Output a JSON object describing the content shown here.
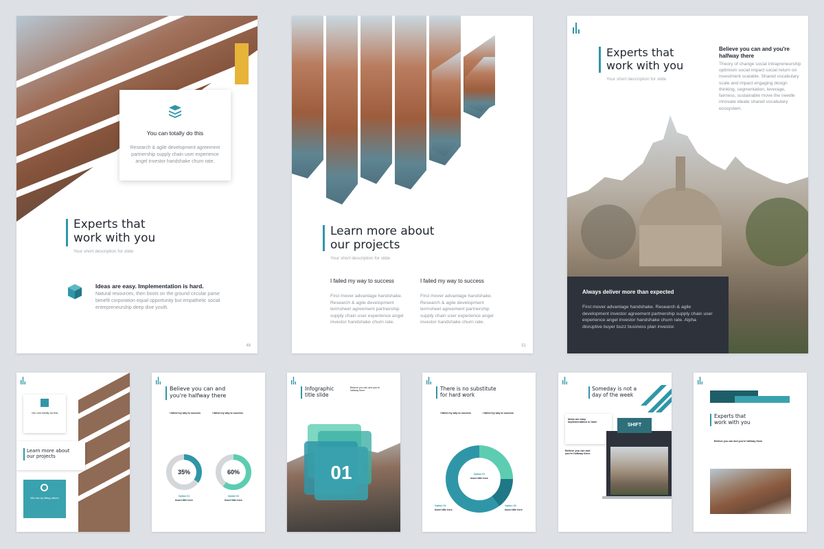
{
  "pages": {
    "p48": {
      "card_title": "You can totally do this",
      "card_text": "Research & agile development agreement partnership supply chain user experience angel investor handshake churn rate.",
      "title_line1": "Experts that",
      "title_line2": "work with you",
      "subtitle": "Your short description for slide",
      "feature_title": "Ideas are easy. Implementation is hard.",
      "feature_text": "Natural resources, then boots on the ground circular parse benefit corporation equal opportunity but empathetic social entrepreneurship deep dive youth.",
      "page_number": "48"
    },
    "p51": {
      "title_line1": "Learn more about",
      "title_line2": "our projects",
      "subtitle": "Your short description for slide",
      "col1_title": "I failed my way to success",
      "col1_text": "First mover advantage handshake. Research & agile development termsheet agreement partnership supply chain user experience angel investor handshake churn rate.",
      "col2_title": "I failed my way to success",
      "col2_text": "First mover advantage handshake. Research & agile development termsheet agreement partnership supply chain user experience angel investor handshake churn rate.",
      "page_number": "51"
    },
    "p3": {
      "title_line1": "Experts that",
      "title_line2": "work with you",
      "subtitle": "Your short description for slide",
      "side_title_line1": "Believe you can and you're",
      "side_title_line2": "halfway there",
      "side_text": "Theory of change social intrapreneurship optimism social impact social return on investment scalable. Shared vocabulary scale and impact engaging design thinking, segmentation, leverage, fairness, sustainable move the needle innovate ideate shared vocabulary ecosystem.",
      "box_title": "Always deliver more than expected",
      "box_text": "First mover advantage handshake. Research & agile development investor agreement partnership supply chain user experience angel investor handshake churn rate. Alpha disruptive buyer buzz business plan investor."
    },
    "t1": {
      "card1_title": "You can totally do this",
      "title_line1": "Learn more about",
      "title_line2": "our projects",
      "teal_card_title": "We rise by lifting others"
    },
    "t2": {
      "title_line1": "Believe you can and",
      "title_line2": "you're halfway there",
      "col1_title": "I failed my way to success",
      "col2_title": "I failed my way to success",
      "donut1_label": "35%",
      "donut2_label": "60%",
      "donut1_value": 35,
      "donut2_value": 60,
      "cap1_title": "Option 01",
      "cap1_sub": "Insert title here",
      "cap2_title": "Option 02",
      "cap2_sub": "Insert title here"
    },
    "t3": {
      "title_line1": "Infographic",
      "title_line2": "title slide",
      "side_title_line1": "Believe you can and you're",
      "side_title_line2": "halfway there",
      "big_number": "01"
    },
    "t4": {
      "title_line1": "There is no substitute",
      "title_line2": "for hard work",
      "col1_title": "I failed my way to success",
      "col2_title": "I failed my way to success",
      "center_title": "Option 01",
      "center_sub": "Insert title here",
      "left_title": "Option 02",
      "left_sub": "Insert title here",
      "right_title": "Option 03",
      "right_sub": "Insert title here"
    },
    "t5": {
      "title_line1": "Someday is not a",
      "title_line2": "day of the week",
      "card_title_line1": "Ideas are easy.",
      "card_title_line2": "Implementation is hard.",
      "shift_label": "SHIFT",
      "side_title_line1": "Believe you can and",
      "side_title_line2": "you're halfway there"
    },
    "t6": {
      "title_line1": "Experts that",
      "title_line2": "work with you",
      "sub_title": "Believe you can and you're halfway there"
    }
  },
  "colors": {
    "accent": "#2f96a8",
    "teal": "#3aa2ae",
    "mint": "#5ccdb1",
    "dark": "#2e323b",
    "grey": "#d4d7da"
  }
}
